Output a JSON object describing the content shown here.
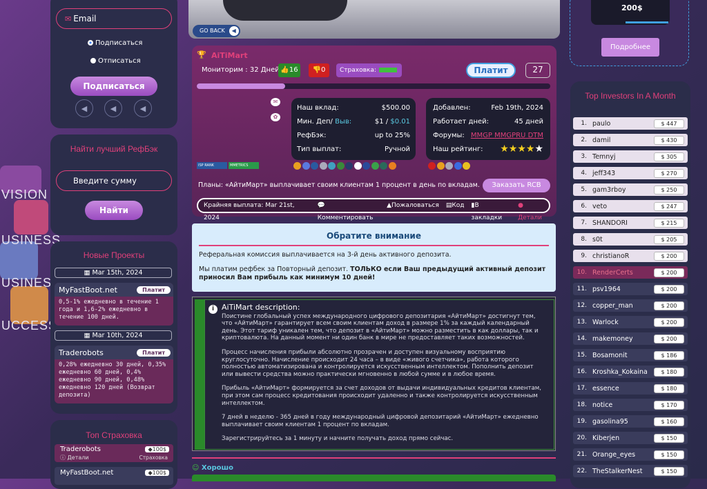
{
  "left": {
    "email_label": "Email",
    "subscribe_option": "Подписаться",
    "unsubscribe_option": "Отписаться",
    "subscribe_button": "Подписаться",
    "refback_title": "Найти лучший РефБэк",
    "amount_placeholder": "Введите сумму",
    "find_button": "Найти",
    "new_projects_title": "Новые Проекты",
    "projects": [
      {
        "date": "Mar 15th, 2024",
        "name": "MyFastBoot.net",
        "status": "Платит",
        "text": "0,5-1% ежедневно в течение 1 года и 1,6-2% ежедневно в течение 100 дней."
      },
      {
        "date": "Mar 10th, 2024",
        "name": "Traderobots",
        "status": "Платит",
        "text": "0,28% ежедневно 30 дней, 0,35% ежедневно 60 дней, 0,4% ежедневно 90 дней, 0,48% ежедневно 120 дней (Возврат депозита)"
      }
    ],
    "insurance_title": "Топ Страховка",
    "insurance": [
      {
        "name": "Tradеrobots",
        "sub": "Детали",
        "amount": "100$",
        "label": "Страховка"
      },
      {
        "name": "MyFastBoot.net",
        "amount": "100$"
      }
    ],
    "bg_words": [
      "VISION",
      "USINESS",
      "USINESS",
      "UCCESS"
    ]
  },
  "main": {
    "go_back": "GO BACK",
    "project_name": "AiTiMart",
    "monitoring": "Мониторим : 32 Дней",
    "likes": "16",
    "dislikes": "0",
    "insurance_label": "Страховка:",
    "status_button": "Платит",
    "rank": "27",
    "progress": 0.25,
    "badges": [
      "ISP RANK",
      "MMETRICS"
    ],
    "info_left": [
      {
        "label": "Наш вклад:",
        "value": "$500.00"
      },
      {
        "label": "Мин. Деп/",
        "label2": "Выв:",
        "value": "$1 /",
        "value2": "$0.01"
      },
      {
        "label": "РефБэк:",
        "value": "up to 25%"
      },
      {
        "label": "Тип выплат:",
        "value": "Ручной"
      }
    ],
    "info_right": [
      {
        "label": "Добавлен:",
        "value": "Feb 19th, 2024"
      },
      {
        "label": "Работает дней:",
        "value": "45 дней"
      },
      {
        "label": "Форумы:",
        "links": [
          "MMGP",
          "MMGPRU",
          "DTM"
        ]
      },
      {
        "label": "Наш рейтинг:",
        "stars": 5
      }
    ],
    "plans": "Планы: «АйтиМарт» выплачивает своим клиентам 1 процент в день по вкладам.",
    "order_rcb": "Заказать RCB",
    "last_payout": "Крайняя выплата: Mar 21st, 2024",
    "actions": [
      "Комментировать",
      "Пожаловаться",
      "Код",
      "В закладки",
      "Детали"
    ],
    "notice_title": "Обратите внимание",
    "notice_p1": "Реферальная комиссия выплачивается на 3-й день активного депозита.",
    "notice_p2a": "Мы платим рефбек за Повторный депозит. ",
    "notice_p2b": "ТОЛЬКО если Ваш предыдущий активный депозит приносил Вам прибыль как минимум 10 дней!",
    "desc_title": "AiTiMart description:",
    "desc_p1": "Поистине глобальный успех международного цифрового депозитария «АйтиМарт» достигнут тем, что «АйтиМарт» гарантирует всем своим клиентам доход в размере 1% за каждый календарный день. Этот тариф уникален тем, что депозит в «АйтиМарт» можно разместить в как доллары, так и криптовалюта. На данный момент ни один банк в мире не предоставляет таких возможностей.",
    "desc_p2": "Процесс начисления прибыли абсолютно прозрачен и доступен визуальному восприятию круглосуточно. Начисление происходит 24 часа – в виде «живого счетчика», работа которого полностью автоматизирована и контролируется искусственным интеллектом. Пополнить депозит или вывести средства можно практически мгновенно в любой сумме и в любое время.",
    "desc_p3": "Прибыль «АйтиМарт» формируется за счет доходов от выдачи индивидуальных кредитов клиентам, при этом сам процесс кредитования происходит удаленно и также контролируется искусственным интеллектом.",
    "desc_p4": "7 дней в неделю - 365 дней в году международный цифровой депозитарий «АйтиМарт» ежедневно выплачивает своим клиентам 1 процент по вкладам.",
    "desc_p5": "Зарегистрируйтесь за 1 минуту и начните получать доход прямо сейчас.",
    "good_label": "Хорошо"
  },
  "right": {
    "promo_amount": "200$",
    "more_button": "Подробнее",
    "investors_title": "Top Investors In A Month",
    "investors": [
      {
        "n": "1.",
        "name": "paulo",
        "amt": "$ 447"
      },
      {
        "n": "2.",
        "name": "damil",
        "amt": "$ 430"
      },
      {
        "n": "3.",
        "name": "Temnyj",
        "amt": "$ 305"
      },
      {
        "n": "4.",
        "name": "jeff343",
        "amt": "$ 270"
      },
      {
        "n": "5.",
        "name": "gam3rboy",
        "amt": "$ 250"
      },
      {
        "n": "6.",
        "name": "veto",
        "amt": "$ 247"
      },
      {
        "n": "7.",
        "name": "SHANDORI",
        "amt": "$ 215"
      },
      {
        "n": "8.",
        "name": "s0t",
        "amt": "$ 205"
      },
      {
        "n": "9.",
        "name": "christianoR",
        "amt": "$ 200"
      },
      {
        "n": "10.",
        "name": "RenderCerts",
        "amt": "$ 200"
      },
      {
        "n": "11.",
        "name": "psv1964",
        "amt": "$ 200"
      },
      {
        "n": "12.",
        "name": "copper_man",
        "amt": "$ 200"
      },
      {
        "n": "13.",
        "name": "Warlock",
        "amt": "$ 200"
      },
      {
        "n": "14.",
        "name": "makemoney",
        "amt": "$ 200"
      },
      {
        "n": "15.",
        "name": "Bosamonit",
        "amt": "$ 186"
      },
      {
        "n": "16.",
        "name": "Kroshka_Kokaina",
        "amt": "$ 180"
      },
      {
        "n": "17.",
        "name": "essence",
        "amt": "$ 180"
      },
      {
        "n": "18.",
        "name": "notice",
        "amt": "$ 170"
      },
      {
        "n": "19.",
        "name": "gasolina95",
        "amt": "$ 160"
      },
      {
        "n": "20.",
        "name": "Kiberjen",
        "amt": "$ 150"
      },
      {
        "n": "21.",
        "name": "Orange_eyes",
        "amt": "$ 150"
      },
      {
        "n": "22.",
        "name": "TheStalkerNest",
        "amt": "$ 150"
      }
    ]
  },
  "colors": {
    "accent": "#e0407a",
    "brand": "#7a2a6a",
    "panel": "#2b2d4a",
    "highlight": "#9a4cc0"
  }
}
